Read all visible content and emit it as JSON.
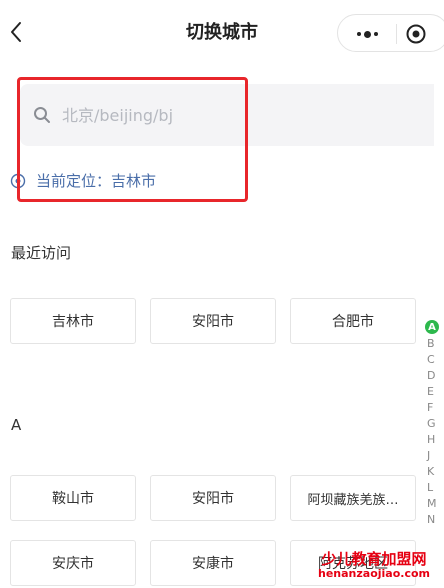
{
  "nav": {
    "title": "切换城市"
  },
  "search": {
    "placeholder": "北京/beijing/bj",
    "value": ""
  },
  "location": {
    "text": "当前定位：吉林市"
  },
  "recent": {
    "title": "最近访问",
    "cities": [
      "吉林市",
      "安阳市",
      "合肥市"
    ]
  },
  "section_a": {
    "title": "A",
    "cities": [
      "鞍山市",
      "安阳市",
      "阿坝藏族羌族…",
      "安庆市",
      "安康市",
      "阿克苏地区"
    ]
  },
  "index_letters": [
    "A",
    "B",
    "C",
    "D",
    "E",
    "F",
    "G",
    "H",
    "J",
    "K",
    "L",
    "M",
    "N"
  ],
  "watermark": {
    "cn": "少儿教育加盟网",
    "en": "henanzaojiao.com"
  },
  "colors": {
    "highlight": "#e8262b",
    "location_text": "#4a6ea9",
    "index_active": "#2db84d",
    "watermark": "#e60012"
  }
}
